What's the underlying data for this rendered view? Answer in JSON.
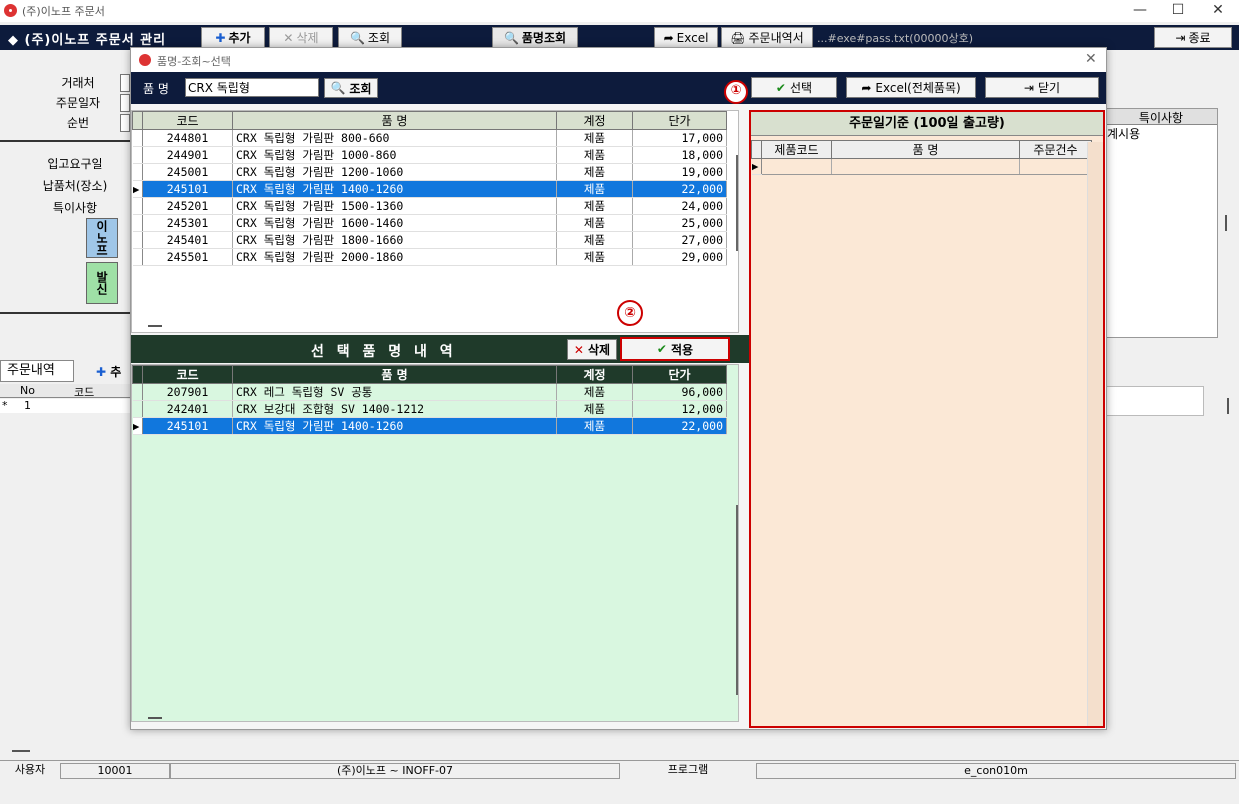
{
  "window": {
    "title": "(주)이노프 주문서",
    "minimize": "—",
    "maximize": "☐",
    "close": "✕"
  },
  "toolbar": {
    "brand": "◆ (주)이노프 주문서 관리",
    "add": "추가",
    "delete": "삭제",
    "query": "조회",
    "item_query": "품명조회",
    "excel": "Excel",
    "order_detail": "주문내역서",
    "file_path": "...#exe#pass.txt(00000상호)",
    "exit": "종료"
  },
  "form": {
    "labels": [
      "거래처",
      "주문일자",
      "순번"
    ],
    "labels2": [
      "입고요구일",
      "납품처(장소)",
      "특이사항"
    ],
    "side_boxes": [
      "이노프",
      "발신"
    ],
    "right_header": "특이사항",
    "right_value": "계시용"
  },
  "orders": {
    "tab": "주문내역",
    "add_label": "추",
    "headers": [
      "No",
      "코드"
    ],
    "rows": [
      {
        "no": "1"
      }
    ]
  },
  "modal": {
    "title": "품명-조회~선택",
    "close": "✕",
    "search_label": "품  명",
    "search_value": "CRX 독립형",
    "search_button": "조회",
    "select_button": "선택",
    "excel_button": "Excel(전체품목)",
    "close_button": "닫기",
    "marker1": "①",
    "marker2": "②",
    "headers": [
      "코드",
      "품 명",
      "계정",
      "단가"
    ],
    "items": [
      {
        "code": "244801",
        "name": "CRX 독립형 가림판 800-660",
        "acct": "제품",
        "price": "17,000"
      },
      {
        "code": "244901",
        "name": "CRX 독립형 가림판 1000-860",
        "acct": "제품",
        "price": "18,000"
      },
      {
        "code": "245001",
        "name": "CRX 독립형 가림판 1200-1060",
        "acct": "제품",
        "price": "19,000"
      },
      {
        "code": "245101",
        "name": "CRX 독립형 가림판 1400-1260",
        "acct": "제품",
        "price": "22,000"
      },
      {
        "code": "245201",
        "name": "CRX 독립형 가림판 1500-1360",
        "acct": "제품",
        "price": "24,000"
      },
      {
        "code": "245301",
        "name": "CRX 독립형 가림판 1600-1460",
        "acct": "제품",
        "price": "25,000"
      },
      {
        "code": "245401",
        "name": "CRX 독립형 가림판 1800-1660",
        "acct": "제품",
        "price": "27,000"
      },
      {
        "code": "245501",
        "name": "CRX 독립형 가림판 2000-1860",
        "acct": "제품",
        "price": "29,000"
      }
    ],
    "selected_header": "선 택  품 명  내 역",
    "selected_delete": "삭제",
    "selected_apply": "적용",
    "selected_items": [
      {
        "code": "207901",
        "name": "CRX 레그 독립형 SV 공통",
        "acct": "제품",
        "price": "96,000"
      },
      {
        "code": "242401",
        "name": "CRX 보강대 조합형 SV 1400-1212",
        "acct": "제품",
        "price": "12,000"
      },
      {
        "code": "245101",
        "name": "CRX 독립형 가림판 1400-1260",
        "acct": "제품",
        "price": "22,000"
      }
    ],
    "right_title": "주문일기준 (100일 출고량)",
    "right_headers": [
      "제품코드",
      "품  명",
      "주문건수"
    ]
  },
  "status": {
    "user_label": "사용자",
    "user_id": "10001",
    "company": "(주)이노프 ~ INOFF-07",
    "program_label": "프로그램",
    "program": "e_con010m"
  },
  "colors": {
    "navy": "#0d1b3c",
    "selection": "#1177dd",
    "accent_red": "#cc0000",
    "panel_peach": "#fbe8d6",
    "lower_green": "#d9f7e0"
  }
}
